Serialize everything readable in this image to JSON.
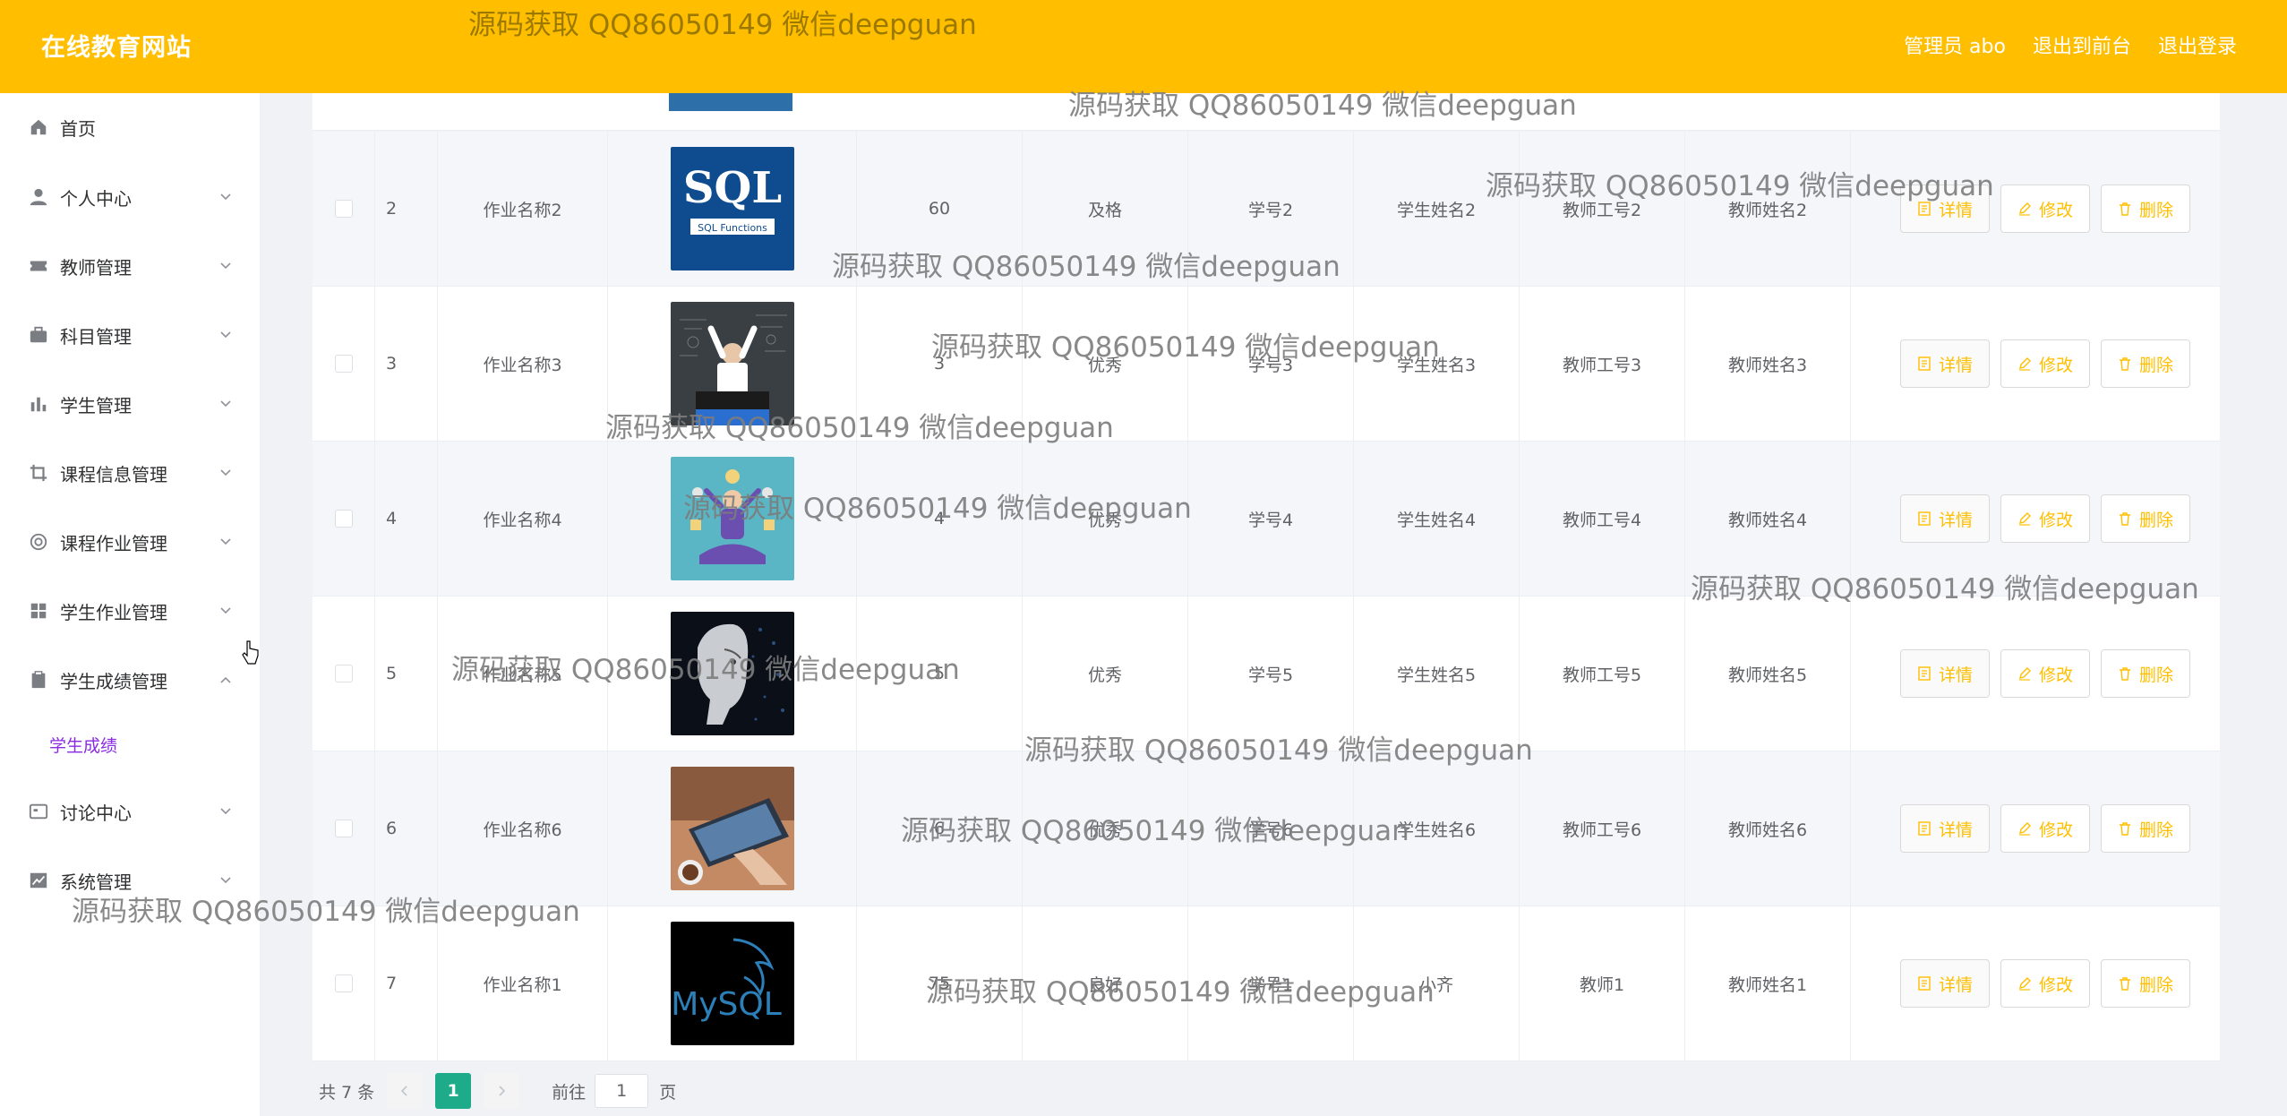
{
  "header": {
    "brand": "在线教育网站",
    "admin_label": "管理员 abo",
    "to_front": "退出到前台",
    "logout": "退出登录"
  },
  "sidebar": {
    "items": [
      {
        "label": "首页",
        "icon": "home-icon",
        "has_arrow": false
      },
      {
        "label": "个人中心",
        "icon": "user-icon",
        "has_arrow": true
      },
      {
        "label": "教师管理",
        "icon": "ticket-icon",
        "has_arrow": true
      },
      {
        "label": "科目管理",
        "icon": "briefcase-icon",
        "has_arrow": true
      },
      {
        "label": "学生管理",
        "icon": "bar-chart-icon",
        "has_arrow": true
      },
      {
        "label": "课程信息管理",
        "icon": "crop-icon",
        "has_arrow": true
      },
      {
        "label": "课程作业管理",
        "icon": "target-icon",
        "has_arrow": true
      },
      {
        "label": "学生作业管理",
        "icon": "grid-icon",
        "has_arrow": true
      },
      {
        "label": "学生成绩管理",
        "icon": "clipboard-icon",
        "has_arrow": true,
        "expanded": true
      },
      {
        "label": "讨论中心",
        "icon": "chat-card-icon",
        "has_arrow": true
      },
      {
        "label": "系统管理",
        "icon": "line-chart-icon",
        "has_arrow": true
      }
    ],
    "subitem": "学生成绩"
  },
  "table": {
    "rows": [
      {
        "index": "2",
        "name": "作业名称2",
        "image": "sql-functions-book",
        "image_text": "SQL",
        "image_subtext": "SQL Functions",
        "score": "60",
        "grade": "及格",
        "student_no": "学号2",
        "student_name": "学生姓名2",
        "teacher_no": "教师工号2",
        "teacher_name": "教师姓名2"
      },
      {
        "index": "3",
        "name": "作业名称3",
        "image": "chalkboard-student",
        "score": "3",
        "grade": "优秀",
        "student_no": "学号3",
        "student_name": "学生姓名3",
        "teacher_no": "教师工号3",
        "teacher_name": "教师姓名3"
      },
      {
        "index": "4",
        "name": "作业名称4",
        "image": "meditation-illustration",
        "score": "4",
        "grade": "优秀",
        "student_no": "学号4",
        "student_name": "学生姓名4",
        "teacher_no": "教师工号4",
        "teacher_name": "教师姓名4"
      },
      {
        "index": "5",
        "name": "作业名称5",
        "image": "ai-robot-face",
        "score": "5",
        "grade": "优秀",
        "student_no": "学号5",
        "student_name": "学生姓名5",
        "teacher_no": "教师工号5",
        "teacher_name": "教师姓名5"
      },
      {
        "index": "6",
        "name": "作业名称6",
        "image": "laptop-coffee",
        "score": "6",
        "grade": "优秀",
        "student_no": "学号6",
        "student_name": "学生姓名6",
        "teacher_no": "教师工号6",
        "teacher_name": "教师姓名6"
      },
      {
        "index": "7",
        "name": "作业名称1",
        "image": "mysql-logo",
        "image_text": "MySQL",
        "score": "75",
        "grade": "良好",
        "student_no": "学号1",
        "student_name": "小齐",
        "teacher_no": "教师1",
        "teacher_name": "教师姓名1"
      }
    ],
    "actions": {
      "detail": "详情",
      "edit": "修改",
      "delete": "删除"
    }
  },
  "pagination": {
    "total": "共 7 条",
    "current": "1",
    "goto": "前往",
    "page_input": "1",
    "unit": "页"
  },
  "watermark": "源码获取 QQ86050149 微信deepguan",
  "colors": {
    "header": "#ffbf00",
    "accent": "#ffbf00",
    "active_page": "#1dab8a",
    "submenu_active": "#8a2be2"
  }
}
